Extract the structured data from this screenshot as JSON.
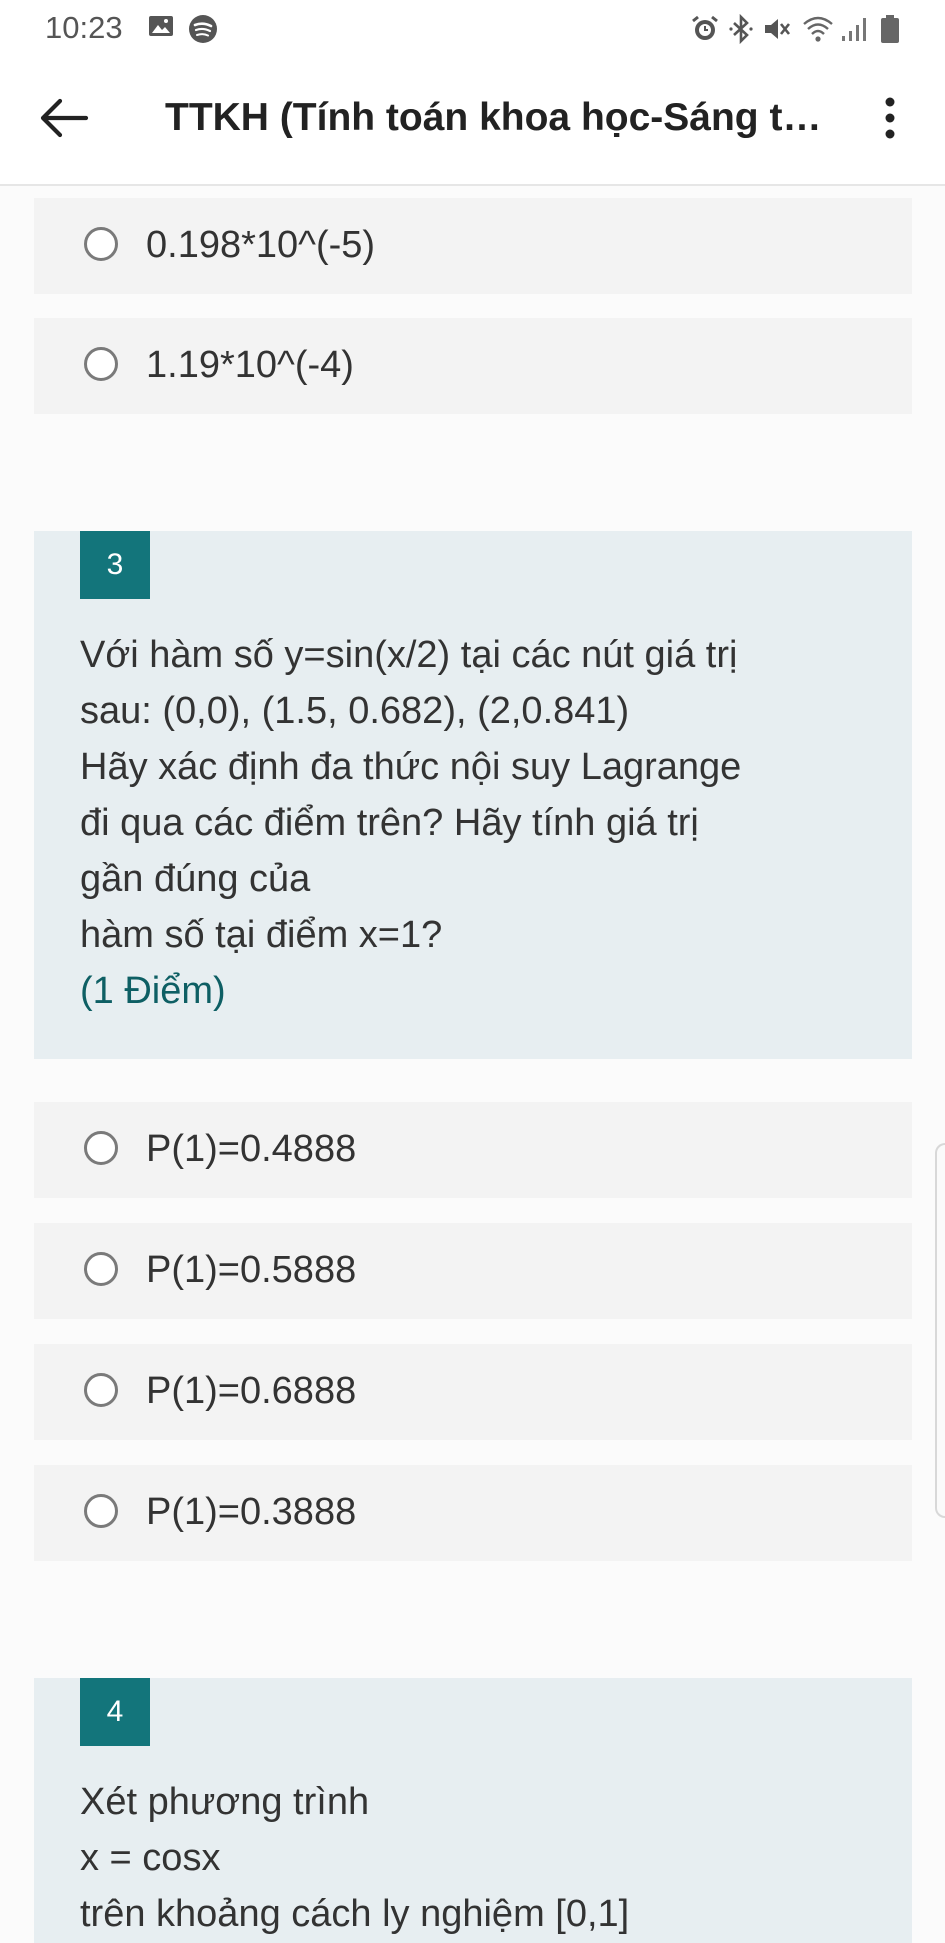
{
  "status_bar": {
    "time": "10:23",
    "icons": [
      "image-icon",
      "spotify-icon",
      "alarm-icon",
      "bluetooth-icon",
      "mute-icon",
      "wifi-icon",
      "signal-icon",
      "battery-icon"
    ]
  },
  "app_bar": {
    "title": "TTKH (Tính toán khoa học-Sáng th...",
    "back_icon": "arrow-left-icon",
    "more_icon": "more-vertical-icon"
  },
  "previous_options": [
    {
      "label": "0.198*10^(-5)"
    },
    {
      "label": "1.19*10^(-4)"
    }
  ],
  "question3": {
    "number": "3",
    "lines": [
      "Với hàm số y=sin(x/2) tại các nút giá trị",
      "sau: (0,0), (1.5, 0.682), (2,0.841)",
      "Hãy xác định đa thức nội suy Lagrange",
      "đi qua các điểm trên? Hãy tính giá trị",
      "gần đúng của",
      "hàm số tại điểm x=1?"
    ],
    "points": "(1 Điểm)",
    "options": [
      {
        "label": "P(1)=0.4888"
      },
      {
        "label": "P(1)=0.5888"
      },
      {
        "label": "P(1)=0.6888"
      },
      {
        "label": "P(1)=0.3888"
      }
    ]
  },
  "question4": {
    "number": "4",
    "lines": [
      "Xét phương trình",
      "x = cosx",
      "trên khoảng cách ly nghiệm [0,1]"
    ]
  },
  "colors": {
    "accent": "#13757b",
    "question_bg": "#e7eef1",
    "option_bg": "#f3f3f3"
  }
}
